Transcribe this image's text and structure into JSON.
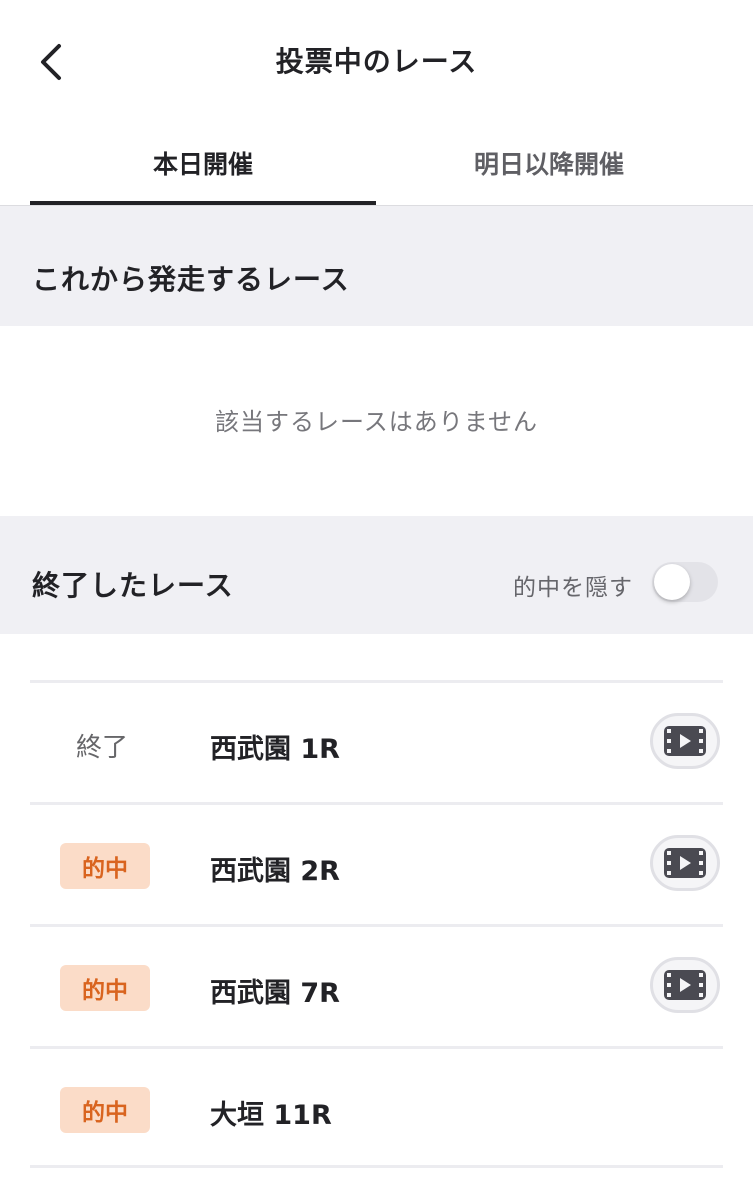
{
  "header": {
    "title": "投票中のレース"
  },
  "tabs": [
    {
      "label": "本日開催",
      "active": true
    },
    {
      "label": "明日以降開催",
      "active": false
    }
  ],
  "upcoming": {
    "title": "これから発走するレース",
    "empty_message": "該当するレースはありません"
  },
  "finished": {
    "title": "終了したレース",
    "hide_hits_label": "的中を隠す",
    "hide_hits_enabled": false,
    "races": [
      {
        "status": "終了",
        "status_type": "finished",
        "name": "西武園 1R",
        "has_video": true
      },
      {
        "status": "的中",
        "status_type": "hit",
        "name": "西武園 2R",
        "has_video": true
      },
      {
        "status": "的中",
        "status_type": "hit",
        "name": "西武園 7R",
        "has_video": true
      },
      {
        "status": "的中",
        "status_type": "hit",
        "name": "大垣 11R",
        "has_video": false
      }
    ]
  },
  "colors": {
    "hit_badge_bg": "#fbdcc8",
    "hit_badge_text": "#d9641f",
    "section_bg": "#f0f0f4"
  },
  "icons": {
    "back": "chevron-left-icon",
    "video": "film-play-icon"
  }
}
